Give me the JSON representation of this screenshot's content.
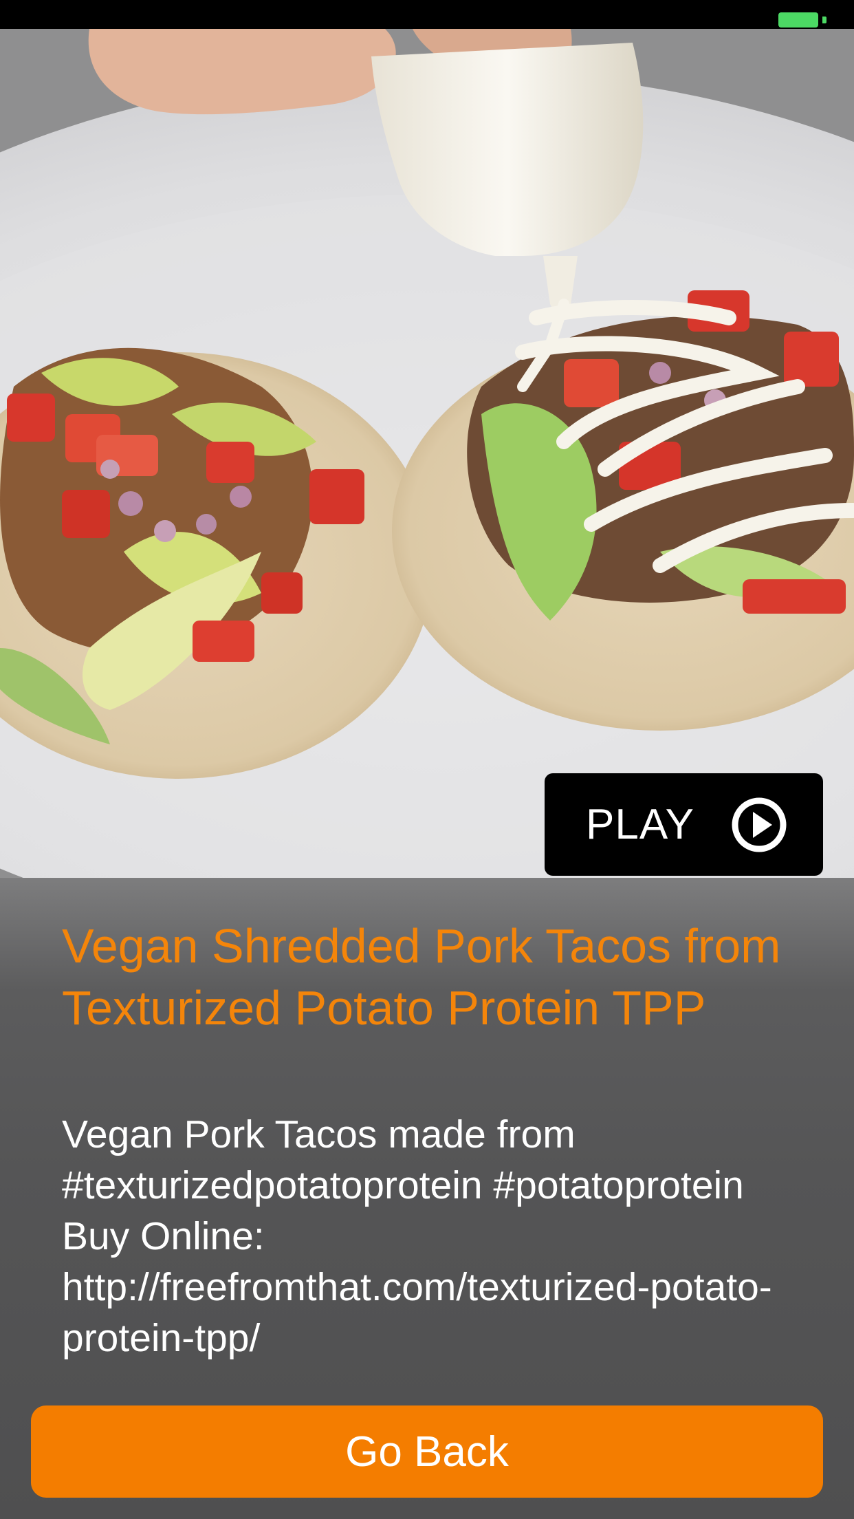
{
  "status_bar": {
    "battery_color": "#4cd964"
  },
  "hero": {
    "image_subject": "tacos-on-plate",
    "play_label": "PLAY",
    "play_icon": "play-circle-icon"
  },
  "video": {
    "title": "Vegan Shredded Pork Tacos from Texturized Potato Protein TPP",
    "description": "Vegan Pork Tacos made from #texturizedpotatoprotein #potatoprotein Buy Online: http://freefromthat.com/texturized-potato-protein-tpp/"
  },
  "footer": {
    "go_back_label": "Go Back"
  },
  "colors": {
    "accent": "#f47d00",
    "title": "#f4850a",
    "play_bg": "#000000"
  }
}
